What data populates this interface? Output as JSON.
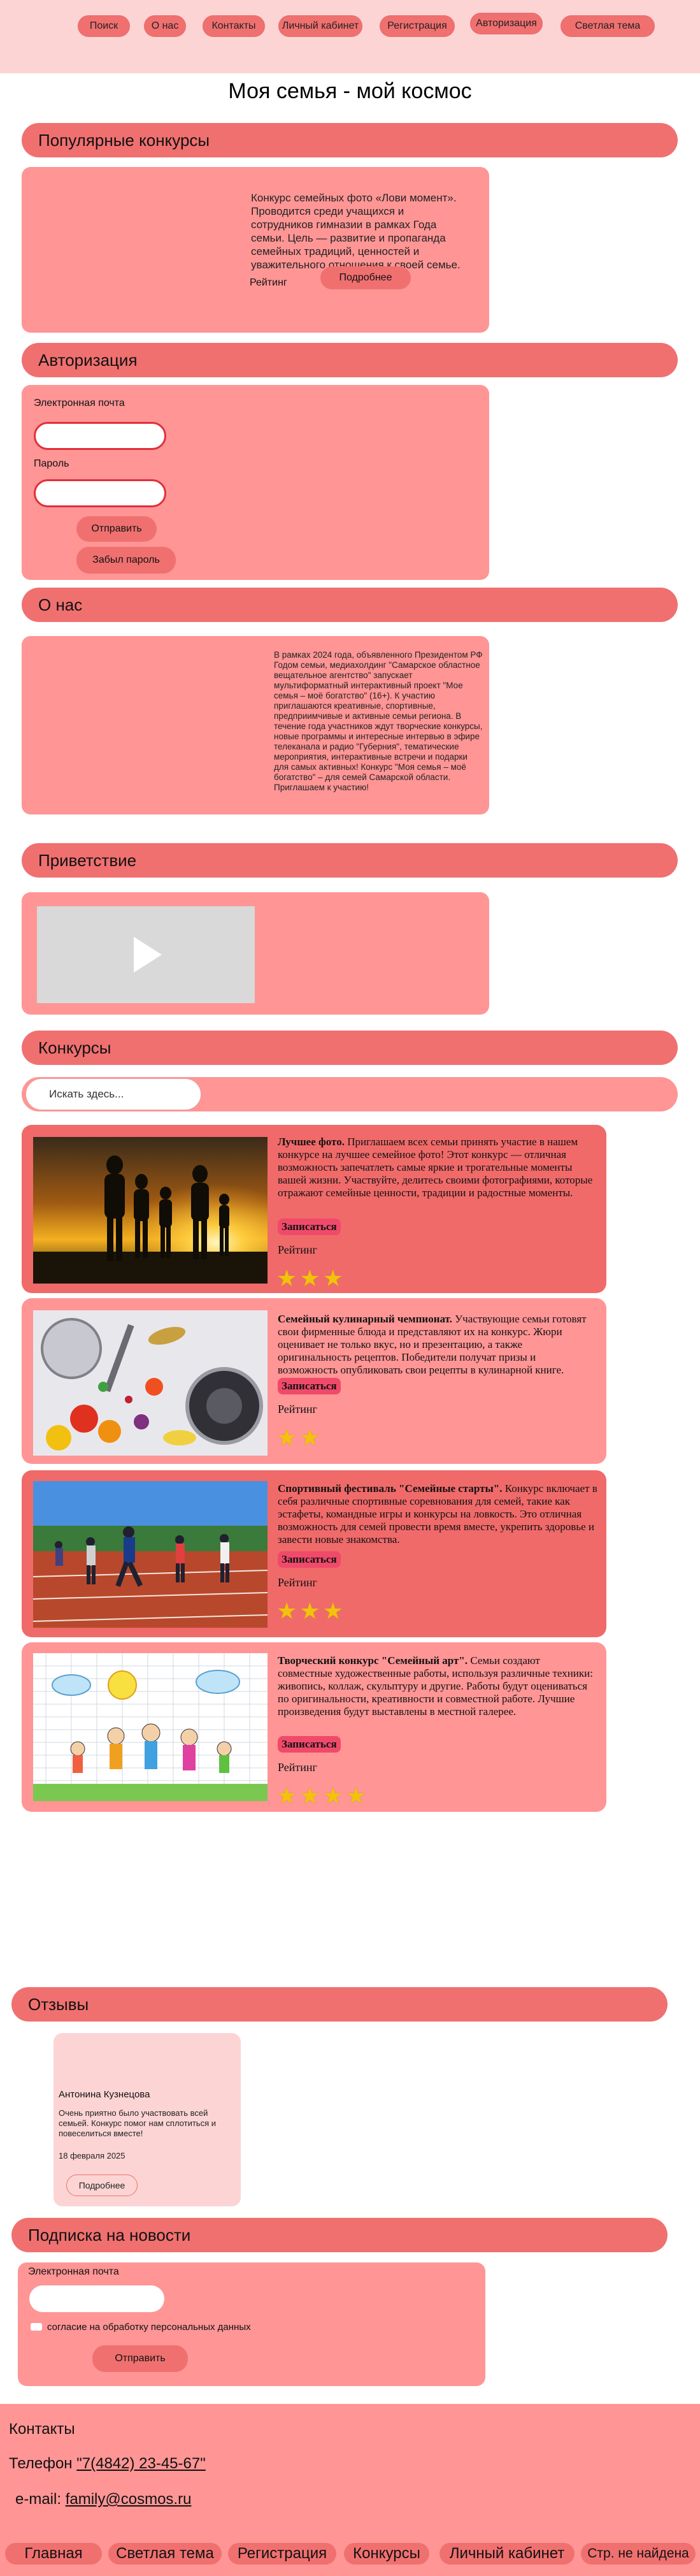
{
  "nav": {
    "items": [
      "Поиск",
      "О нас",
      "Контакты",
      "Личный кабинет",
      "Регистрация",
      "Авторизация",
      "Светлая тема"
    ]
  },
  "page": {
    "title": "Моя семья - мой космос"
  },
  "popular": {
    "heading": "Популярные конкурсы",
    "description": "Конкурс семейных фото «Лови момент». Проводится среди учащихся и сотрудников гимназии в рамках Года семьи. Цель — развитие и пропаганда семейных традиций, ценностей и уважительного отношения к своей семье.",
    "rating_label": "Рейтинг",
    "more_label": "Подробнее"
  },
  "auth": {
    "heading": "Авторизация",
    "email_label": "Электронная почта",
    "password_label": "Пароль",
    "submit_label": "Отправить",
    "forgot_label": "Забыл пароль"
  },
  "about": {
    "heading": "О нас",
    "text": "В рамках 2024 года, объявленного Президентом РФ Годом семьи, медиахолдинг \"Самарское областное вещательное агентство\" запускает мультиформатный интерактивный проект \"Мое семья – моё богатство\" (16+). К участию приглашаются креативные, спортивные, предприимчивые и активные семьи региона. В течение года участников ждут творческие конкурсы, новые программы и интересные интервью в эфире телеканала и радио \"Губерния\", тематические мероприятия, интерактивные встречи и подарки для самых активных! Конкурс \"Моя семья – моё богатство\" – для семей Самарской области. Приглашаем к участию!"
  },
  "greeting": {
    "heading": "Приветствие"
  },
  "contests": {
    "heading": "Конкурсы",
    "search_placeholder": "Искать здесь...",
    "items": [
      {
        "title": "Лучшее фото.",
        "text": "Приглашаем всех семьи принять участие в нашем конкурсе на лучшее семейное фото! Этот конкурс — отличная возможность запечатлеть самые яркие и трогательные моменты вашей жизни. Участвуйте, делитесь своими фотографиями, которые отражают семейные ценности, традиции и радостные моменты.",
        "signup": "Записаться",
        "rating": "Рейтинг",
        "stars": 3,
        "color": "#f06a6a",
        "image": "family-sunset"
      },
      {
        "title": "Семейный кулинарный чемпионат.",
        "text": "Участвующие семьи готовят свои фирменные блюда и представляют их на конкурс. Жюри оценивает не только вкус, но и презентацию, а также оригинальность рецептов. Победители получат призы и возможность опубликовать свои рецепты в кулинарной книге.",
        "signup": "Записаться",
        "rating": "Рейтинг",
        "stars": 2,
        "color": "#ff9595",
        "image": "kitchen"
      },
      {
        "title": "Спортивный фестиваль \"Семейные старты\".",
        "text": "Конкурс включает в себя различные спортивные соревнования для семей, такие как эстафеты, командные игры и конкурсы на ловкость. Это отличная возможность для семей провести время вместе, укрепить здоровье и завести новые знакомства.",
        "signup": "Записаться",
        "rating": "Рейтинг",
        "stars": 3,
        "color": "#f06a6a",
        "image": "sports"
      },
      {
        "title": "Творческий конкурс \"Семейный арт\".",
        "text": "Семьи создают совместные художественные работы, используя различные техники: живопись, коллаж, скульптуру и другие. Работы будут оцениваться по оригинальности, креативности и совместной работе. Лучшие произведения будут выставлены в местной галерее.",
        "signup": "Записаться",
        "rating": "Рейтинг",
        "stars": 4,
        "color": "#ff9595",
        "image": "drawing"
      }
    ]
  },
  "reviews": {
    "heading": "Отзывы",
    "name": "Антонина Кузнецова",
    "text": "Очень приятно было участвовать всей семьей. Конкурс помог нам сплотиться и повеселиться вместе!",
    "date": "18 февраля 2025",
    "more_label": "Подробнее"
  },
  "subscribe": {
    "heading": "Подписка на новости",
    "email_label": "Электронная почта",
    "consent_label": "согласие на обработку персональных данных",
    "submit_label": "Отправить"
  },
  "footer": {
    "contacts_heading": "Контакты",
    "phone_label": "Телефон",
    "phone_value": "\"7(4842) 23-45-67\"",
    "email_label": "e-mail:",
    "email_value": "family@cosmos.ru",
    "links": [
      "Главная",
      "Светлая тема",
      "Регистрация",
      "Конкурсы",
      "Личный кабинет",
      "Стр. не найдена"
    ]
  },
  "colors": {
    "accent": "#f07070",
    "card": "#ff9595",
    "topbar": "#fcd4d4",
    "star": "#f3c20c",
    "signup": "#f04a6a"
  }
}
